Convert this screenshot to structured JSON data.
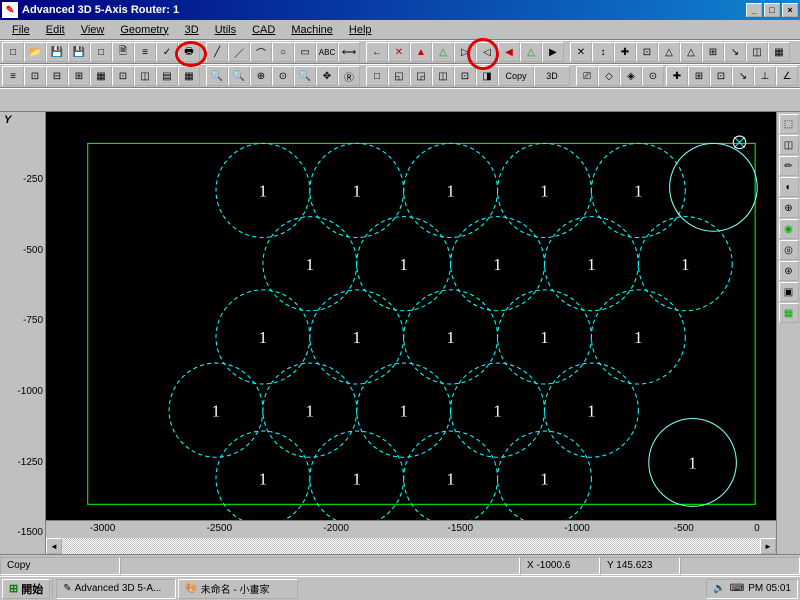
{
  "title": "Advanced 3D 5-Axis Router: 1",
  "menu": [
    "File",
    "Edit",
    "View",
    "Geometry",
    "3D",
    "Utils",
    "CAD",
    "Machine",
    "Help"
  ],
  "copy_btn": "Copy",
  "threeD": "3D",
  "ruler_y_label": "Y",
  "ruler_y": [
    {
      "v": "-250",
      "pct": 14
    },
    {
      "v": "-500",
      "pct": 30
    },
    {
      "v": "-750",
      "pct": 46
    },
    {
      "v": "-1000",
      "pct": 62
    },
    {
      "v": "-1250",
      "pct": 78
    },
    {
      "v": "-1500",
      "pct": 94
    }
  ],
  "ruler_x": [
    {
      "v": "-3000",
      "pct": 6
    },
    {
      "v": "-2500",
      "pct": 22
    },
    {
      "v": "-2000",
      "pct": 38
    },
    {
      "v": "-1500",
      "pct": 55
    },
    {
      "v": "-1000",
      "pct": 71
    },
    {
      "v": "-500",
      "pct": 86
    },
    {
      "v": "0",
      "pct": 98
    }
  ],
  "status_left": "Copy",
  "status_x": "X -1000.6",
  "status_y": "Y 145.623",
  "start": "開始",
  "task1": "Advanced 3D 5-A...",
  "task2": "未命名 - 小畫家",
  "clock": "PM 05:01",
  "circle_label": "1"
}
